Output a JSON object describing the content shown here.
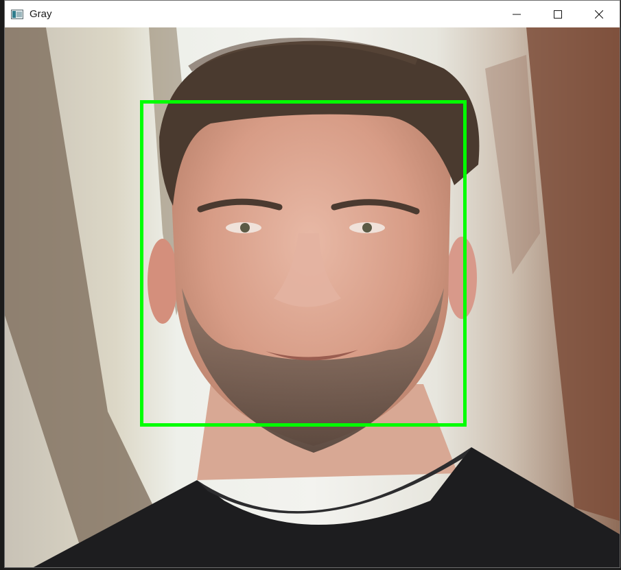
{
  "window": {
    "title": "Gray",
    "app_icon": "opencv-window-icon",
    "controls": {
      "minimize_icon": "minimize-icon",
      "maximize_icon": "maximize-icon",
      "close_icon": "close-icon"
    }
  },
  "image": {
    "subject": "portrait-photo",
    "detection_box_color": "#00ff00"
  }
}
